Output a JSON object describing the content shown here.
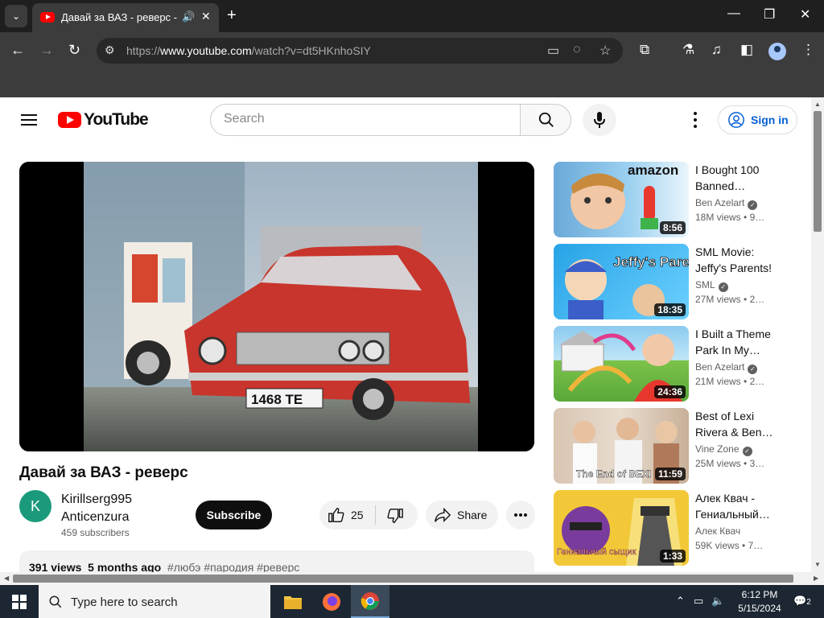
{
  "browser": {
    "tab_title": "Давай за ВАЗ - реверс - YouTube",
    "url_prefix": "https://",
    "url_host": "www.youtube.com",
    "url_path": "/watch?v=dt5HKnhoSIY"
  },
  "header": {
    "logo_text": "YouTube",
    "search_placeholder": "Search",
    "signin_label": "Sign in"
  },
  "video": {
    "title": "Давай за ВАЗ - реверс",
    "plate": "1468 ТЕ",
    "channel_initial": "K",
    "channel_name": "Kirillserg995 Anticenzura",
    "subscribers": "459 subscribers",
    "subscribe_label": "Subscribe",
    "likes": "25",
    "share_label": "Share",
    "views": "391 views",
    "age": "5 months ago",
    "tags": "#любэ #пародия #реверс"
  },
  "recommendations": [
    {
      "title": "I Bought 100 Banned…",
      "channel": "Ben Azelart",
      "verified": true,
      "views": "18M views",
      "age": "9…",
      "duration": "8:56",
      "thumb_text": "amazon"
    },
    {
      "title": "SML Movie: Jeffy's Parents!",
      "channel": "SML",
      "verified": true,
      "views": "27M views",
      "age": "2…",
      "duration": "18:35",
      "thumb_text": "Jeffy's Parents"
    },
    {
      "title": "I Built a Theme Park In My…",
      "channel": "Ben Azelart",
      "verified": true,
      "views": "21M views",
      "age": "2…",
      "duration": "24:36",
      "thumb_text": ""
    },
    {
      "title": "Best of Lexi Rivera & Ben…",
      "channel": "Vine Zone",
      "verified": true,
      "views": "25M views",
      "age": "3…",
      "duration": "11:59",
      "thumb_text": "The End of BEXI"
    },
    {
      "title": "Алек Квач - Гениальный…",
      "channel": "Алек Квач",
      "verified": false,
      "views": "59K views",
      "age": "7…",
      "duration": "1:33",
      "thumb_text": "Гениальный сыщик -"
    }
  ],
  "taskbar": {
    "search_placeholder": "Type here to search",
    "time": "6:12 PM",
    "date": "5/15/2024",
    "notifications": "2"
  },
  "colors": {
    "brand_red": "#ff0000",
    "link_blue": "#065fd4",
    "chrome_dark": "#3c3c3c",
    "taskbar": "#1c2733"
  }
}
